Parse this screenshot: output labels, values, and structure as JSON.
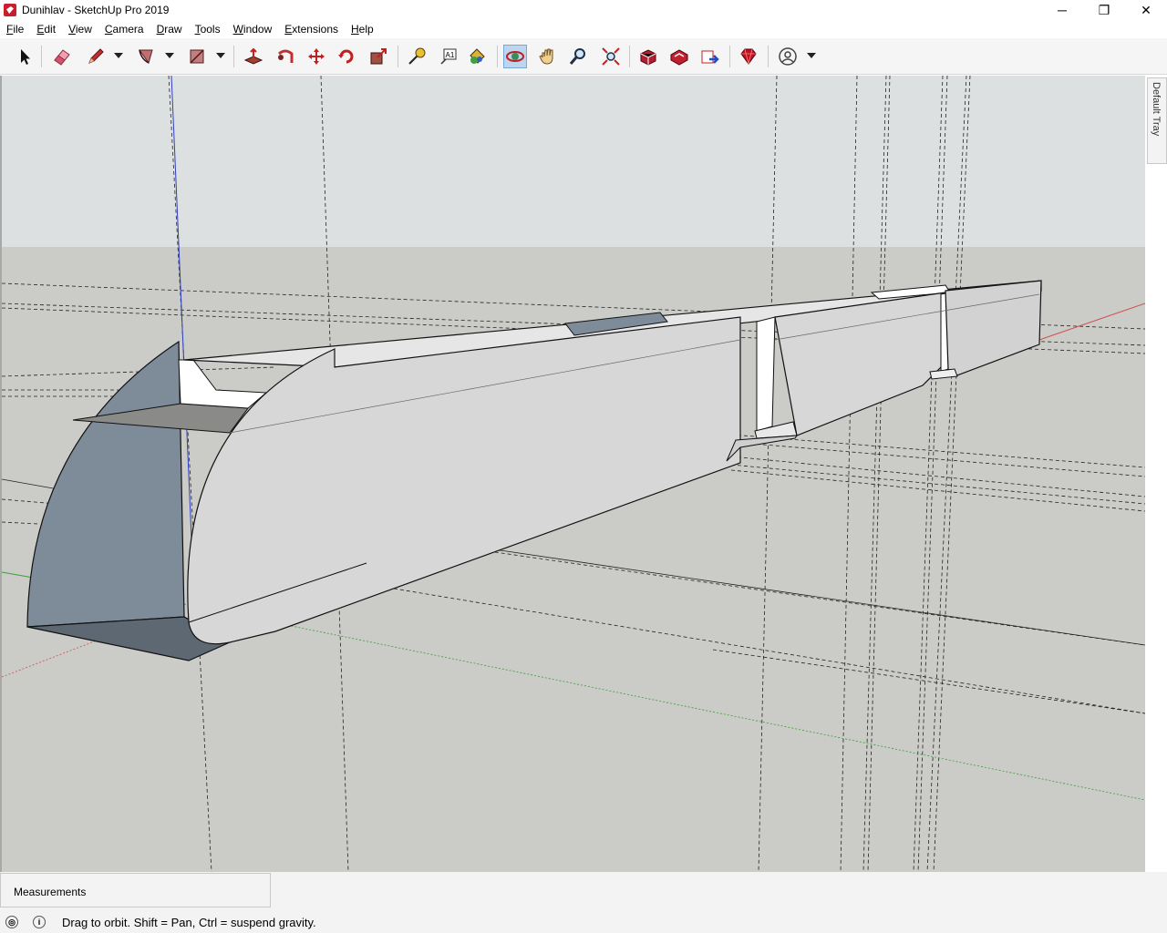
{
  "window": {
    "title": "Dunihlav - SketchUp Pro 2019",
    "minimize_glyph": "─",
    "restore_glyph": "❐",
    "close_glyph": "✕"
  },
  "menu": [
    "File",
    "Edit",
    "View",
    "Camera",
    "Draw",
    "Tools",
    "Window",
    "Extensions",
    "Help"
  ],
  "toolbar": {
    "tools": [
      {
        "name": "select-tool",
        "icon": "arrow-icon"
      },
      {
        "name": "eraser-tool",
        "icon": "eraser-icon"
      },
      {
        "name": "line-tool",
        "icon": "pencil-icon"
      },
      {
        "name": "arc-tool",
        "icon": "arc-icon"
      },
      {
        "name": "rectangle-tool",
        "icon": "rectangle-icon"
      },
      {
        "name": "push-pull-tool",
        "icon": "push-pull-icon"
      },
      {
        "name": "follow-me-tool",
        "icon": "follow-me-icon"
      },
      {
        "name": "move-tool",
        "icon": "move-icon"
      },
      {
        "name": "rotate-tool",
        "icon": "rotate-icon"
      },
      {
        "name": "scale-tool",
        "icon": "scale-icon"
      },
      {
        "name": "tape-measure-tool",
        "icon": "tape-measure-icon"
      },
      {
        "name": "text-tool",
        "icon": "text-icon"
      },
      {
        "name": "paint-bucket-tool",
        "icon": "paint-bucket-icon"
      },
      {
        "name": "orbit-tool",
        "icon": "orbit-icon",
        "active": true
      },
      {
        "name": "pan-tool",
        "icon": "hand-icon"
      },
      {
        "name": "zoom-tool",
        "icon": "magnifier-icon"
      },
      {
        "name": "zoom-extents-tool",
        "icon": "zoom-extents-icon"
      },
      {
        "name": "3d-warehouse",
        "icon": "warehouse-icon"
      },
      {
        "name": "extension-warehouse",
        "icon": "extension-warehouse-icon"
      },
      {
        "name": "share-model",
        "icon": "share-model-icon"
      },
      {
        "name": "extension-manager",
        "icon": "ruby-icon"
      },
      {
        "name": "account",
        "icon": "user-icon"
      }
    ],
    "text_tool_glyph": "A1"
  },
  "tray": {
    "label": "Default Tray"
  },
  "measurements": {
    "label": "Measurements",
    "value": ""
  },
  "status": {
    "text": "Drag to orbit. Shift = Pan, Ctrl = suspend gravity."
  },
  "colors": {
    "sky": "#dde0e0",
    "ground": "#cbcbc7",
    "face_front": "#d7d7d7",
    "face_back": "#7e8b98",
    "axis_red": "#d05050",
    "axis_green": "#3aa03a",
    "axis_blue": "#3040c0",
    "active_tool": "#bcd6ef"
  }
}
